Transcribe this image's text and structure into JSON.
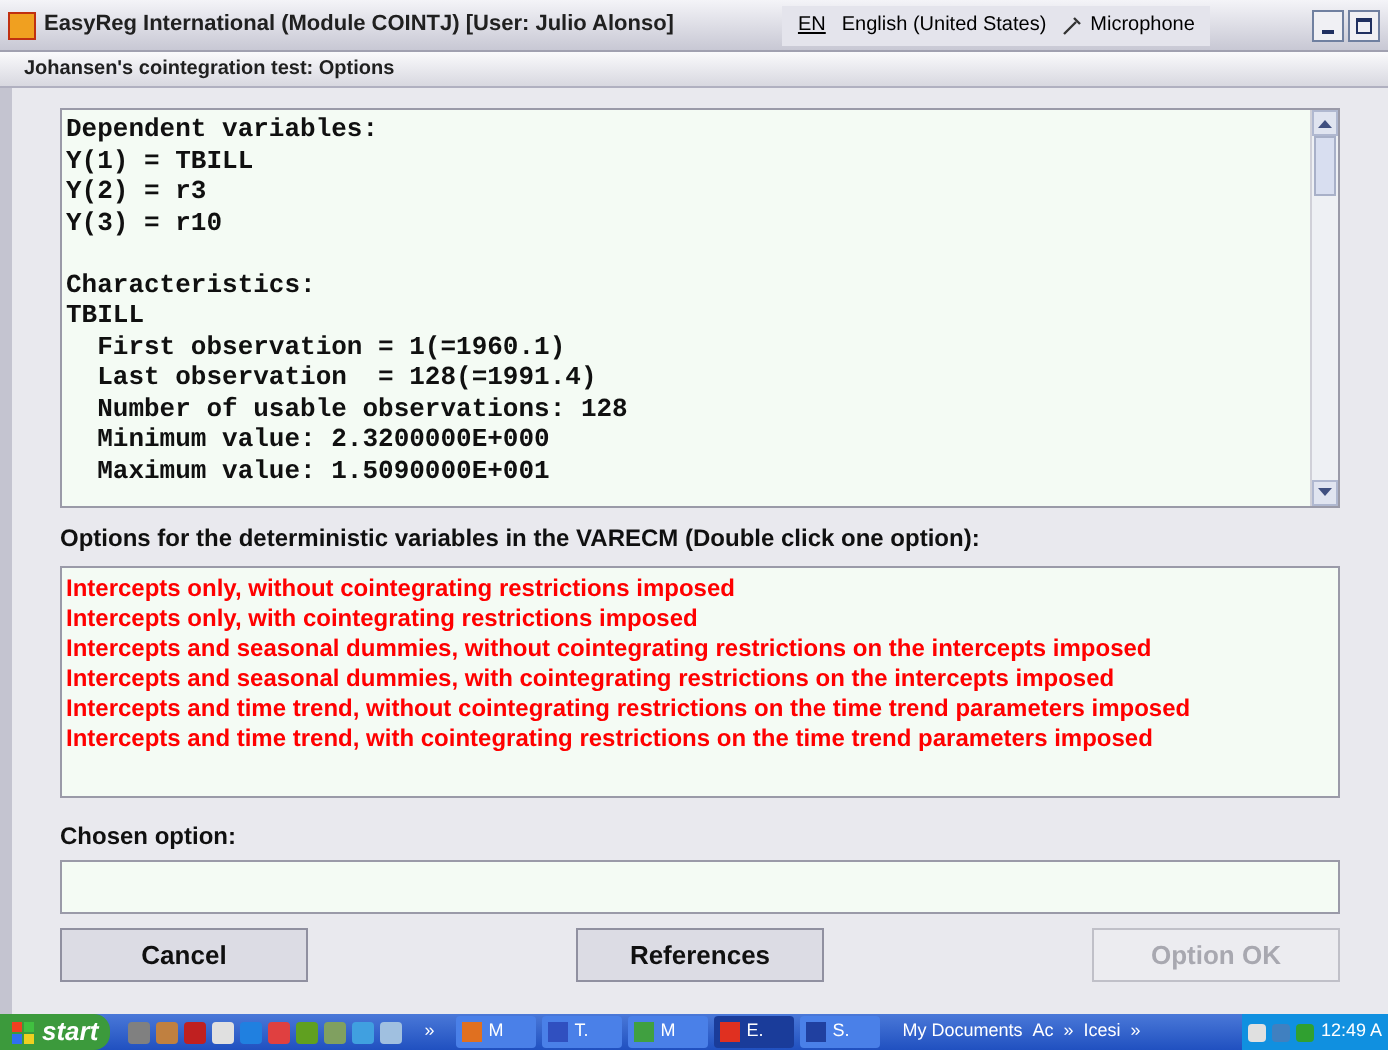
{
  "window": {
    "title": "EasyReg International (Module COINTJ) [User: Julio Alonso]"
  },
  "language_bar": {
    "code": "EN",
    "language": "English (United States)",
    "microphone": "Microphone"
  },
  "dialog": {
    "title": "Johansen's cointegration test: Options"
  },
  "output_blocks": [
    [
      "Dependent variables:",
      "Y(1) = TBILL",
      "Y(2) = r3",
      "Y(3) = r10"
    ],
    [
      "Characteristics:",
      "TBILL",
      "  First observation = 1(=1960.1)",
      "  Last observation  = 128(=1991.4)",
      "  Number of usable observations: 128",
      "  Minimum value: 2.3200000E+000",
      "  Maximum value: 1.5090000E+001"
    ]
  ],
  "options_label": "Options for the deterministic variables in the VARECM (Double click one option):",
  "options": [
    "Intercepts only, without cointegrating restrictions imposed",
    "Intercepts only, with cointegrating restrictions imposed",
    "Intercepts and seasonal dummies, without cointegrating restrictions on the intercepts imposed",
    "Intercepts and seasonal dummies, with cointegrating restrictions on the intercepts imposed",
    "Intercepts and time trend, without cointegrating restrictions on the time trend parameters imposed",
    "Intercepts and time trend, with cointegrating restrictions on the time trend parameters imposed"
  ],
  "chosen_label": "Chosen option:",
  "buttons": [
    {
      "label": "Cancel",
      "disabled": false
    },
    {
      "label": "References",
      "disabled": false
    },
    {
      "label": "Option OK",
      "disabled": true
    }
  ],
  "taskbar": {
    "start": "start",
    "quick_more": "»",
    "tasks": [
      {
        "label": "M",
        "color": "#e07020",
        "selected": false
      },
      {
        "label": "T.",
        "color": "#3050c0",
        "selected": false
      },
      {
        "label": "M",
        "color": "#40a040",
        "selected": false
      },
      {
        "label": "E.",
        "color": "#e03020",
        "selected": true
      },
      {
        "label": "S.",
        "color": "#2040a0",
        "selected": false
      }
    ],
    "toolbars": [
      "My Documents",
      "Ac",
      "»",
      "Icesi",
      "»"
    ],
    "clock": "12:49 A"
  }
}
